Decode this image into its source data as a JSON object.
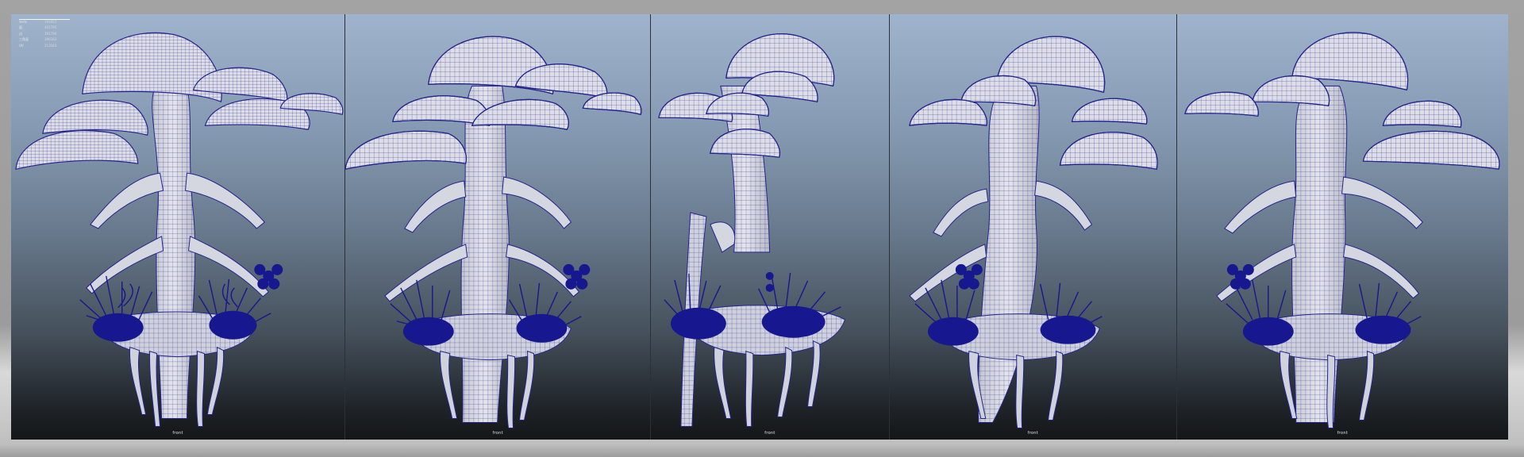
{
  "viewport": {
    "camera_label": "front"
  },
  "hud_stats": [
    {
      "label": "Verts",
      "value": "193957"
    },
    {
      "label": "面",
      "value": "401795"
    },
    {
      "label": "边",
      "value": "391790"
    },
    {
      "label": "三角面",
      "value": "396183"
    },
    {
      "label": "UV",
      "value": "213183"
    }
  ],
  "colors": {
    "mesh_wire": "#24248c",
    "foliage": "#17178f",
    "surface": "#d8d9e3",
    "bg_top": "#9fb3cc",
    "bg_bottom": "#141618"
  }
}
